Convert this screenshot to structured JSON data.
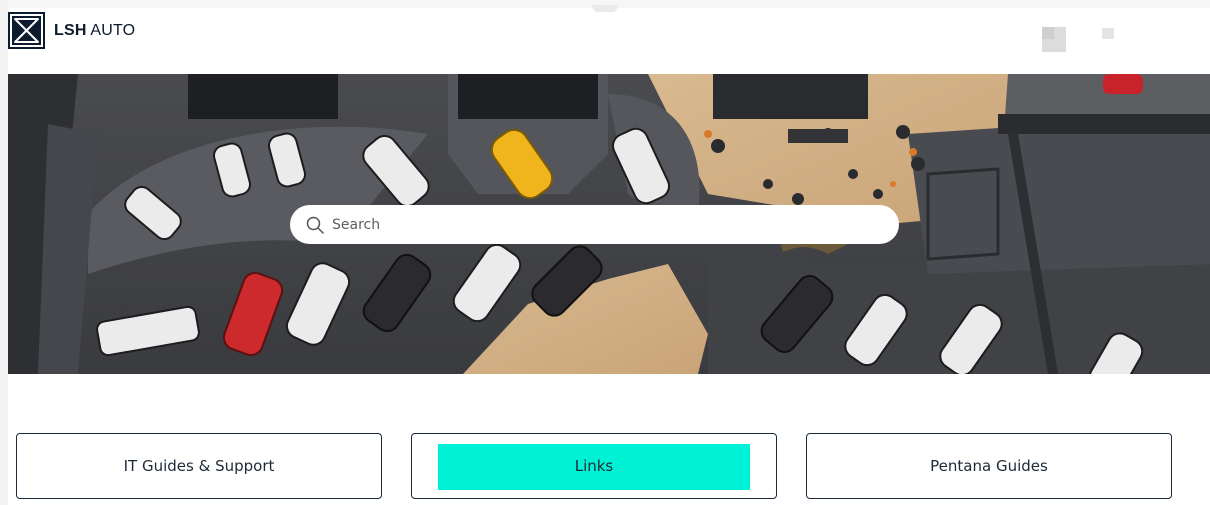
{
  "header": {
    "brand_bold": "LSH",
    "brand_regular": "AUTO"
  },
  "search": {
    "placeholder": "Search"
  },
  "tiles": [
    {
      "label": "IT Guides & Support"
    },
    {
      "label": "Links"
    },
    {
      "label": "Pentana Guides"
    }
  ],
  "colors": {
    "navy": "#0d1b2e",
    "accent_cyan": "#00f2d6",
    "floor_dark": "#3b3c40"
  },
  "icons": {
    "logo": "hourglass-x-logo",
    "search": "search-icon"
  }
}
